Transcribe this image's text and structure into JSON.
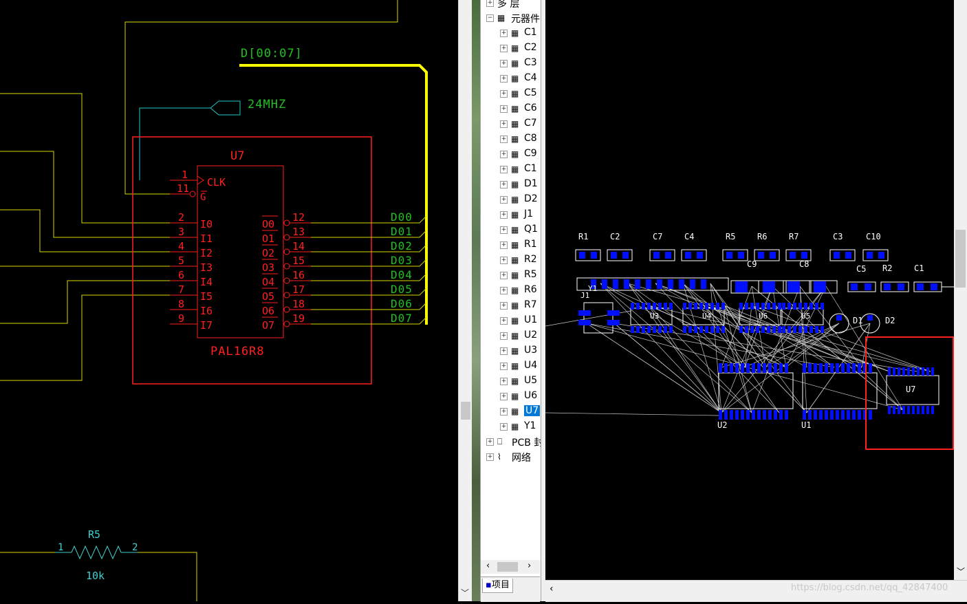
{
  "schematic": {
    "bus_label": "D[00:07]",
    "clock_net": "24MHZ",
    "part_refdes": "U7",
    "part_value": "PAL16R8",
    "clk_pin_name": "CLK",
    "g_pin_name": "G",
    "left_pins": [
      {
        "num": "1",
        "name": "CLK"
      },
      {
        "num": "11",
        "name": "G"
      },
      {
        "num": "2",
        "name": "I0"
      },
      {
        "num": "3",
        "name": "I1"
      },
      {
        "num": "4",
        "name": "I2"
      },
      {
        "num": "5",
        "name": "I3"
      },
      {
        "num": "6",
        "name": "I4"
      },
      {
        "num": "7",
        "name": "I5"
      },
      {
        "num": "8",
        "name": "I6"
      },
      {
        "num": "9",
        "name": "I7"
      }
    ],
    "right_pins": [
      {
        "num": "12",
        "name": "O0",
        "net": "D00"
      },
      {
        "num": "13",
        "name": "O1",
        "net": "D01"
      },
      {
        "num": "14",
        "name": "O2",
        "net": "D02"
      },
      {
        "num": "15",
        "name": "O3",
        "net": "D03"
      },
      {
        "num": "16",
        "name": "O4",
        "net": "D04"
      },
      {
        "num": "17",
        "name": "O5",
        "net": "D05"
      },
      {
        "num": "18",
        "name": "O6",
        "net": "D06"
      },
      {
        "num": "19",
        "name": "O7",
        "net": "D07"
      }
    ],
    "resistor": {
      "refdes": "R5",
      "value": "10k",
      "pin1": "1",
      "pin2": "2"
    },
    "colors": {
      "wire": "#d8d800",
      "bus": "#ffff00",
      "part": "#ff2020",
      "net_label": "#20c020",
      "port": "#20c8c8",
      "resistor": "#40d0d0",
      "highlight": "#ff2020"
    }
  },
  "tree": {
    "top_partial": "多 层",
    "components_label": "元器件",
    "items": [
      "C1",
      "C2",
      "C3",
      "C4",
      "C5",
      "C6",
      "C7",
      "C8",
      "C9",
      "C1",
      "D1",
      "D2",
      "J1",
      "Q1",
      "R1",
      "R2",
      "R5",
      "R6",
      "R7",
      "U1",
      "U2",
      "U3",
      "U4",
      "U5",
      "U6",
      "U7",
      "Y1"
    ],
    "selected": "U7",
    "pcb_label": "PCB 封",
    "nets_label": "网络",
    "tab_label": "项目"
  },
  "pcb": {
    "top_row_labels": [
      "R1",
      "C2",
      "C7",
      "C4",
      "R5",
      "R6",
      "R7",
      "C3",
      "C10"
    ],
    "second_row_labels": [
      "C9",
      "C8",
      "C5",
      "R2",
      "C1"
    ],
    "labels": {
      "y1": "Y1",
      "j1": "J1",
      "u3": "U3",
      "u4": "U4",
      "u6": "U6",
      "u5": "U5",
      "d1": "D1",
      "d2": "D2",
      "u2": "U2",
      "u1": "U1",
      "u7": "U7"
    },
    "colors": {
      "pad": "#0010ff",
      "silk": "#ffffff",
      "rats": "#c8c8c8",
      "select": "#ff2020"
    }
  },
  "watermark": "https://blog.csdn.net/qq_42847400"
}
